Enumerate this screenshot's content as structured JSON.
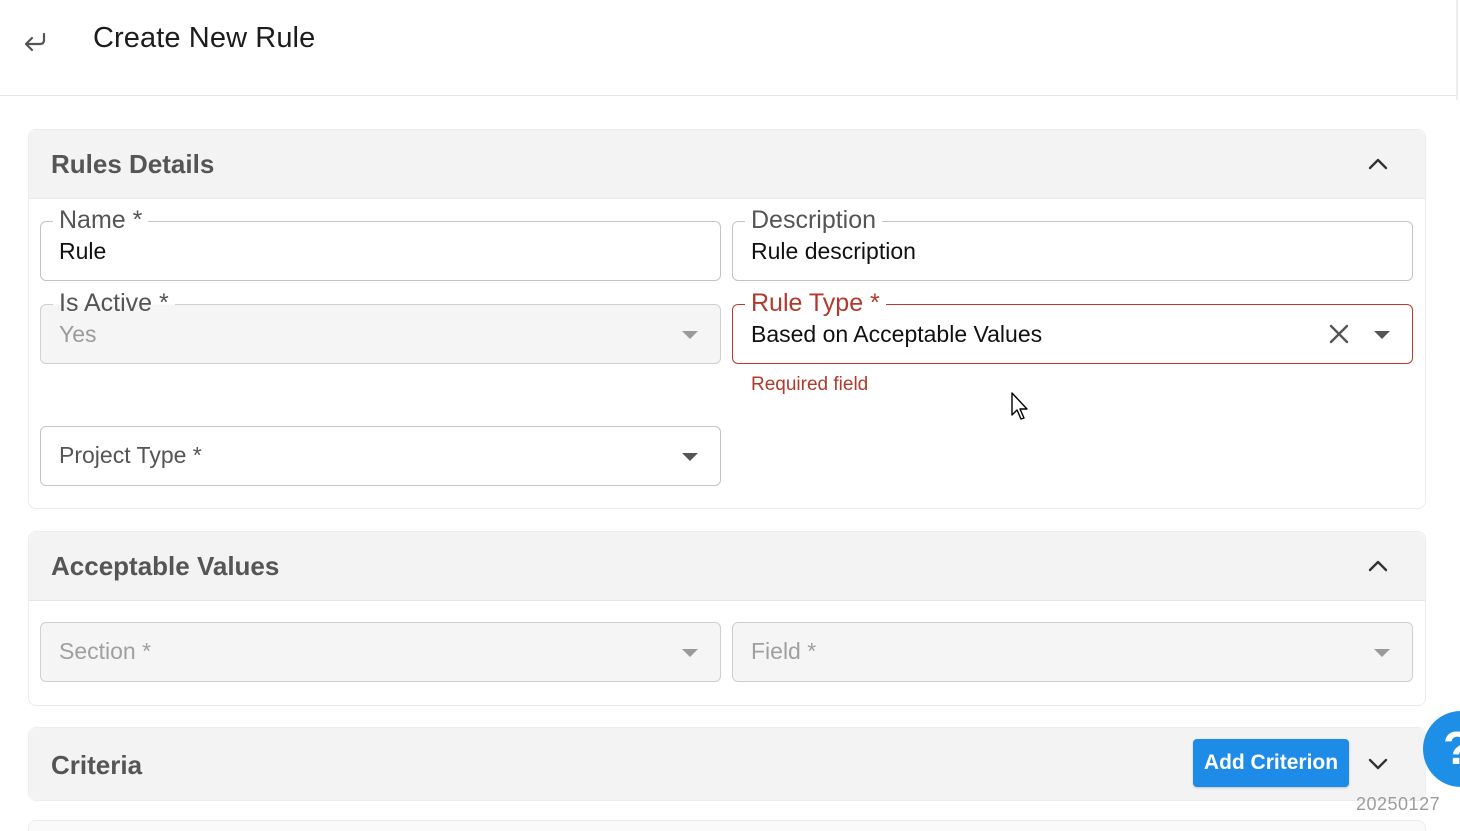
{
  "header": {
    "title": "Create New Rule",
    "back_icon": "back-arrow-icon"
  },
  "rules_details": {
    "title": "Rules Details",
    "name": {
      "label": "Name *",
      "value": "Rule"
    },
    "description": {
      "label": "Description",
      "value": "Rule description"
    },
    "is_active": {
      "label": "Is Active *",
      "value": "Yes"
    },
    "rule_type": {
      "label": "Rule Type *",
      "value": "Based on Acceptable Values",
      "helper": "Required field"
    },
    "project_type": {
      "label": "Project Type *"
    }
  },
  "acceptable_values": {
    "title": "Acceptable Values",
    "section": {
      "label": "Section *"
    },
    "field": {
      "label": "Field *"
    }
  },
  "criteria": {
    "title": "Criteria",
    "add_button": "Add Criterion"
  },
  "help_button": "?",
  "footer_stamp": "20250127",
  "colors": {
    "accent": "#1f8be8",
    "error": "#b23a2c",
    "header_bg": "#f3f3f3"
  }
}
